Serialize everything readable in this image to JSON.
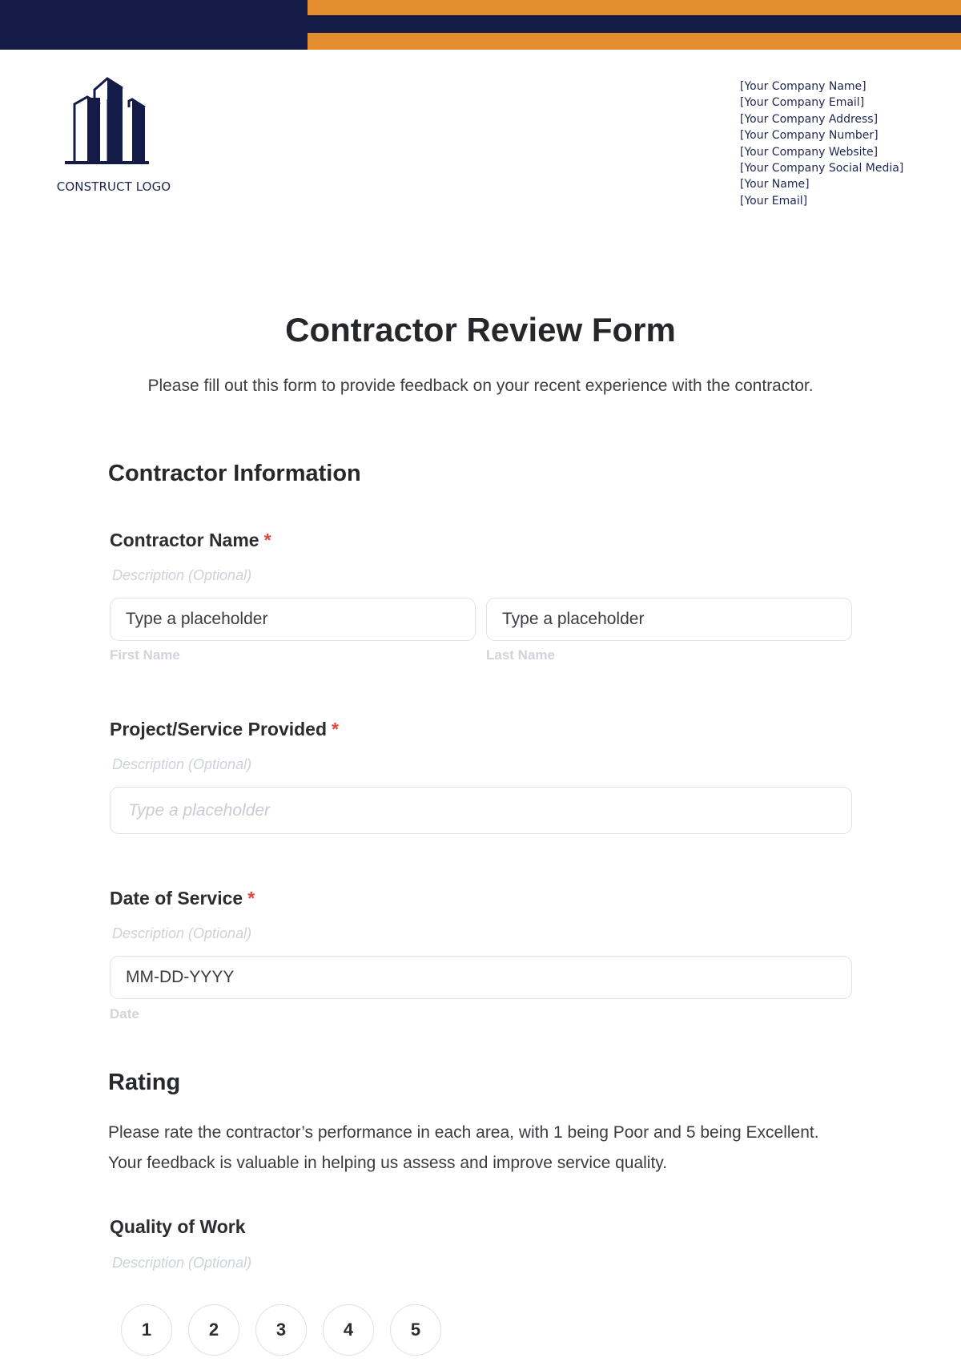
{
  "colors": {
    "navy": "#141b47",
    "orange": "#e38d2f",
    "required": "#e5453b"
  },
  "logo": {
    "icon": "buildings-icon",
    "text": "CONSTRUCT LOGO"
  },
  "company_info": [
    "[Your Company Name]",
    "[Your Company Email]",
    "[Your Company Address]",
    "[Your Company Number]",
    "[Your Company Website]",
    "[Your Company Social Media]",
    "[Your Name]",
    "[Your Email]"
  ],
  "form": {
    "title": "Contractor Review Form",
    "subtitle": "Please fill out this form to provide feedback on your recent experience with the contractor.",
    "sections": {
      "contractor_info": {
        "heading": "Contractor Information",
        "contractor_name": {
          "label": "Contractor Name",
          "required_mark": "*",
          "description": "Description (Optional)",
          "first_name": {
            "value": "Type a placeholder",
            "sublabel": "First Name"
          },
          "last_name": {
            "value": "Type a placeholder",
            "sublabel": "Last Name"
          }
        },
        "project": {
          "label": "Project/Service Provided",
          "required_mark": "*",
          "description": "Description (Optional)",
          "placeholder": "Type a placeholder"
        },
        "date": {
          "label": "Date of Service",
          "required_mark": "*",
          "description": "Description (Optional)",
          "value": "MM-DD-YYYY",
          "sublabel": "Date"
        }
      },
      "rating": {
        "heading": "Rating",
        "instructions": "Please rate the contractor’s performance in each area, with 1 being Poor and 5 being Excellent. Your feedback is valuable in helping us assess and improve service quality.",
        "quality_of_work": {
          "label": "Quality of Work",
          "description": "Description (Optional)",
          "options": [
            "1",
            "2",
            "3",
            "4",
            "5"
          ]
        }
      }
    }
  }
}
